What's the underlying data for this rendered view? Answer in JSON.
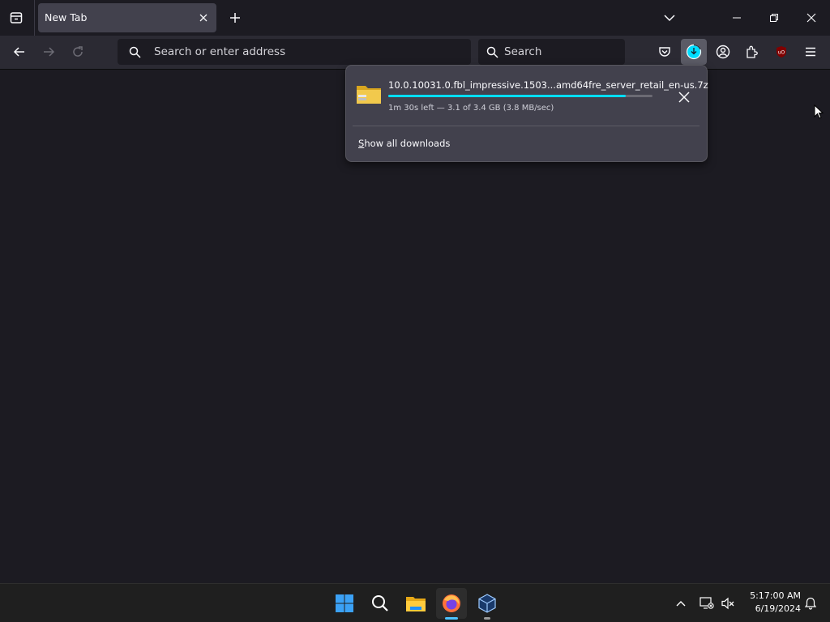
{
  "tabs": [
    {
      "title": "New Tab",
      "active": true
    }
  ],
  "urlbar": {
    "placeholder": "Search or enter address"
  },
  "searchbar": {
    "placeholder": "Search"
  },
  "downloads": {
    "filename": "10.0.10031.0.fbl_impressive.1503...amd64fre_server_retail_en-us.7z",
    "progress_percent": 90,
    "status": "1m 30s left — 3.1 of 3.4 GB (3.8 MB/sec)",
    "show_all_label": "Show all downloads",
    "show_all_access_key": "S"
  },
  "taskbar": {
    "time": "5:17:00 AM",
    "date": "6/19/2024",
    "apps": [
      "start-menu",
      "search",
      "file-explorer",
      "firefox",
      "virtualbox"
    ]
  },
  "colors": {
    "accent": "#00ddff",
    "toolbar": "#2b2a33",
    "tab_active": "#42414d",
    "content_bg": "#1c1b22",
    "ublock": "#800000"
  },
  "icons": {
    "toolbar": [
      "pocket-icon",
      "downloads-icon",
      "account-icon",
      "extensions-icon",
      "ublock-origin-icon",
      "menu-icon"
    ]
  }
}
